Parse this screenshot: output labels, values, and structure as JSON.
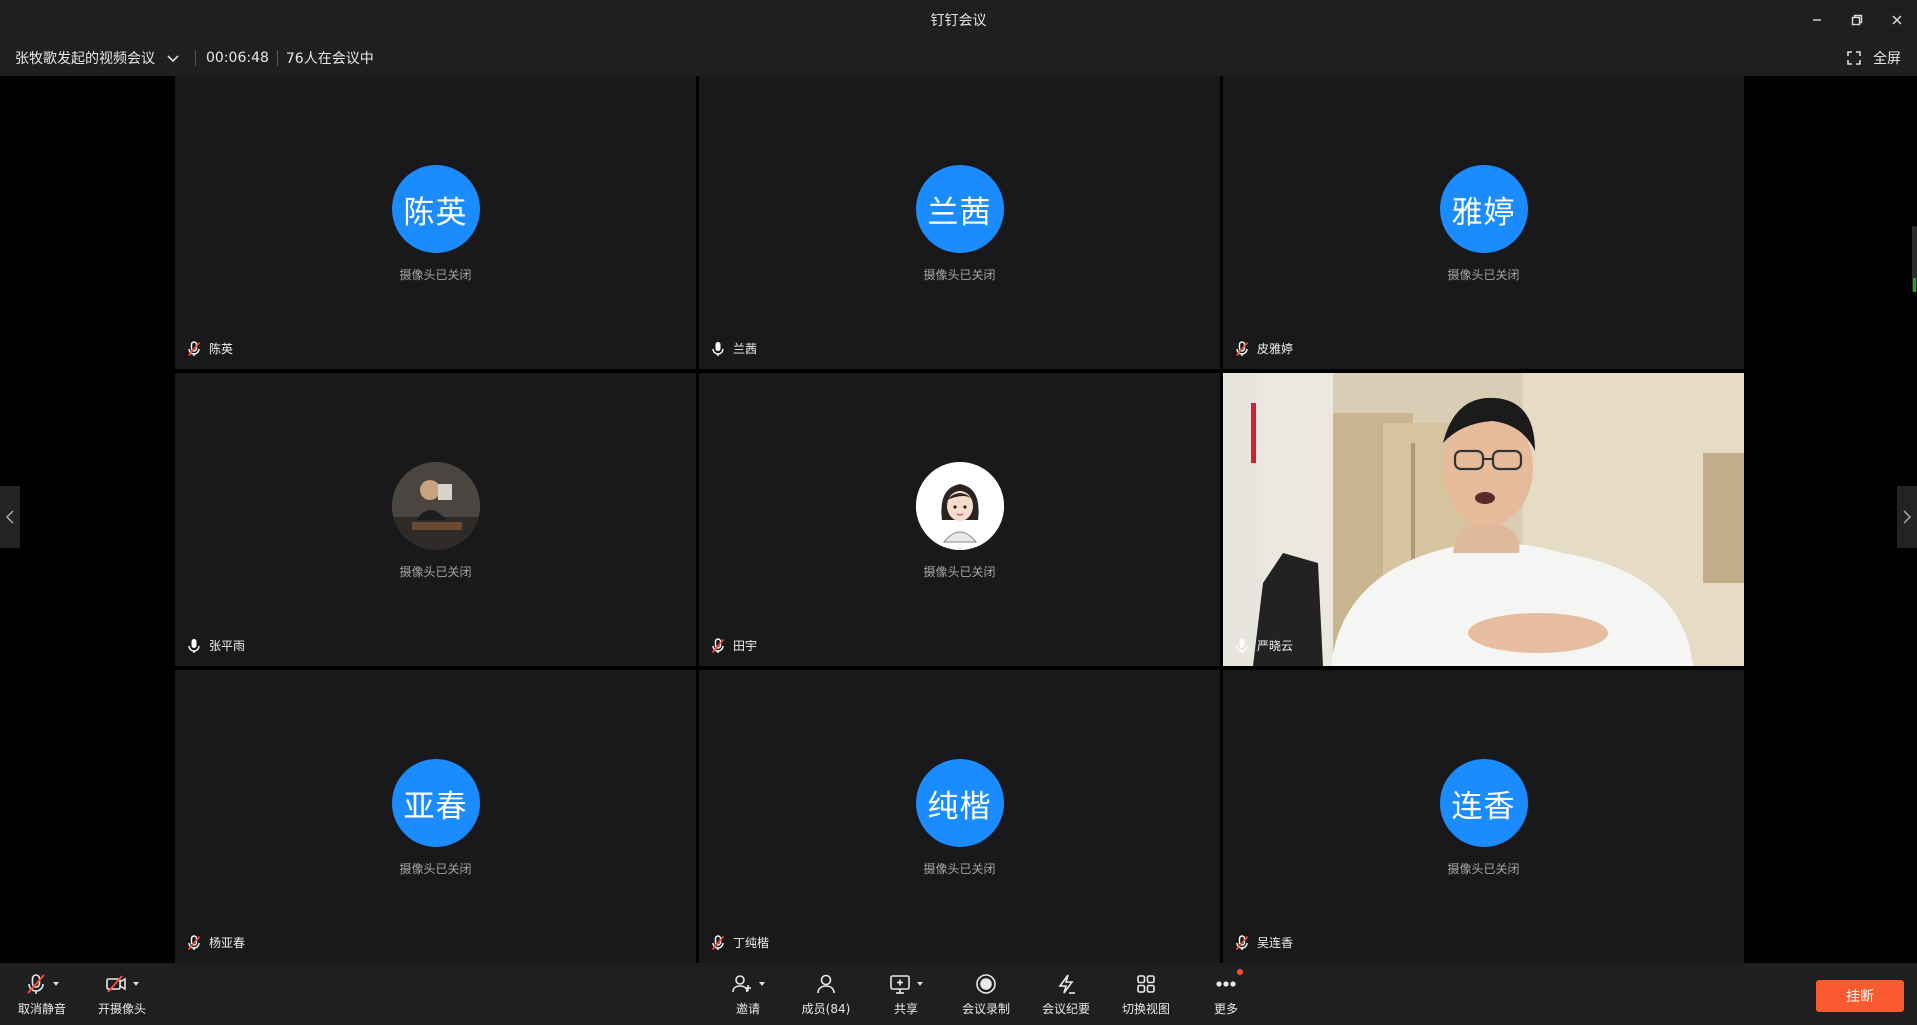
{
  "window": {
    "title": "钉钉会议"
  },
  "info": {
    "meeting_name": "张牧歌发起的视频会议",
    "duration": "00:06:48",
    "in_meeting": "76人在会议中",
    "fullscreen_label": "全屏"
  },
  "tiles": [
    {
      "avatar_text": "陈英",
      "status": "摄像头已关闭",
      "name": "陈英",
      "muted": true
    },
    {
      "avatar_text": "兰茜",
      "status": "摄像头已关闭",
      "name": "兰茜",
      "muted": false
    },
    {
      "avatar_text": "雅婷",
      "status": "摄像头已关闭",
      "name": "皮雅婷",
      "muted": true
    },
    {
      "avatar_text": "",
      "status": "摄像头已关闭",
      "name": "张平雨",
      "muted": false
    },
    {
      "avatar_text": "",
      "status": "摄像头已关闭",
      "name": "田宇",
      "muted": true
    },
    {
      "avatar_text": "",
      "status": "",
      "name": "严晓云",
      "muted": false
    },
    {
      "avatar_text": "亚春",
      "status": "摄像头已关闭",
      "name": "杨亚春",
      "muted": true
    },
    {
      "avatar_text": "纯楷",
      "status": "摄像头已关闭",
      "name": "丁纯楷",
      "muted": true
    },
    {
      "avatar_text": "连香",
      "status": "摄像头已关闭",
      "name": "吴连香",
      "muted": true
    }
  ],
  "toolbar": {
    "unmute": "取消静音",
    "camera": "开摄像头",
    "invite": "邀请",
    "members": "成员(84)",
    "share": "共享",
    "record": "会议录制",
    "minutes": "会议纪要",
    "switch_view": "切换视图",
    "more": "更多",
    "hangup": "挂断"
  },
  "colors": {
    "avatar_blue": "#1a8cff",
    "hangup": "#fa5a30",
    "muted_red": "#ff4d3a"
  }
}
